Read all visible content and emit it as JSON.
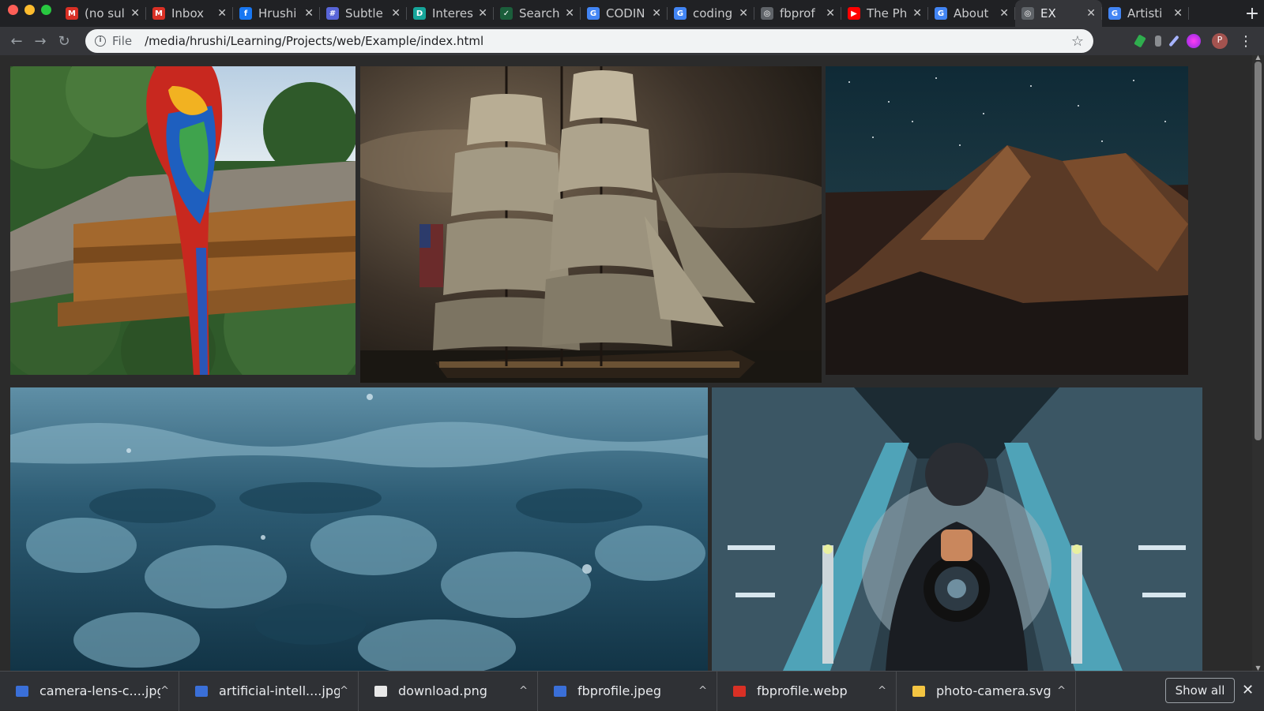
{
  "tabs": [
    {
      "title": "(no sul",
      "favicon": "gmail-icon",
      "color": "#d93025",
      "glyph": "M"
    },
    {
      "title": "Inbox",
      "favicon": "gmail-icon",
      "color": "#d93025",
      "glyph": "M"
    },
    {
      "title": "Hrushi",
      "favicon": "facebook-icon",
      "color": "#1877f2",
      "glyph": "f"
    },
    {
      "title": "Subtle",
      "favicon": "site-icon",
      "color": "#5865d8",
      "glyph": "#"
    },
    {
      "title": "Interes",
      "favicon": "dev-icon",
      "color": "#16a59a",
      "glyph": "D"
    },
    {
      "title": "Search",
      "favicon": "check-icon",
      "color": "#1b5e3b",
      "glyph": "✓"
    },
    {
      "title": "CODIN",
      "favicon": "google-icon",
      "color": "#4285f4",
      "glyph": "G"
    },
    {
      "title": "coding",
      "favicon": "google-icon",
      "color": "#4285f4",
      "glyph": "G"
    },
    {
      "title": "fbprof",
      "favicon": "globe-icon",
      "color": "#5f6368",
      "glyph": "◎"
    },
    {
      "title": "The Ph",
      "favicon": "youtube-icon",
      "color": "#ff0000",
      "glyph": "▶"
    },
    {
      "title": "About",
      "favicon": "google-icon",
      "color": "#4285f4",
      "glyph": "G"
    },
    {
      "title": "EX",
      "favicon": "globe-icon",
      "color": "#5f6368",
      "glyph": "◎",
      "active": true
    },
    {
      "title": "Artisti",
      "favicon": "google-icon",
      "color": "#4285f4",
      "glyph": "G"
    }
  ],
  "toolbar": {
    "scheme": "File",
    "url": "/media/hrushi/Learning/Projects/web/Example/index.html",
    "profile_initial": "P"
  },
  "gallery": [
    {
      "name": "parrot-photo"
    },
    {
      "name": "sailing-ship-photo"
    },
    {
      "name": "mountain-night-photo"
    },
    {
      "name": "water-waves-photo"
    },
    {
      "name": "photographer-escalator-photo"
    }
  ],
  "downloads": [
    {
      "name": "camera-lens-c....jpg",
      "icon_color": "#3a6fd8"
    },
    {
      "name": "artificial-intell....jpg",
      "icon_color": "#3a6fd8"
    },
    {
      "name": "download.png",
      "icon_color": "#e8e8e8"
    },
    {
      "name": "fbprofile.jpeg",
      "icon_color": "#3a6fd8"
    },
    {
      "name": "fbprofile.webp",
      "icon_color": "#d93025"
    },
    {
      "name": "photo-camera.svg",
      "icon_color": "#f4c542"
    }
  ],
  "downloads_bar": {
    "show_all_label": "Show all"
  }
}
